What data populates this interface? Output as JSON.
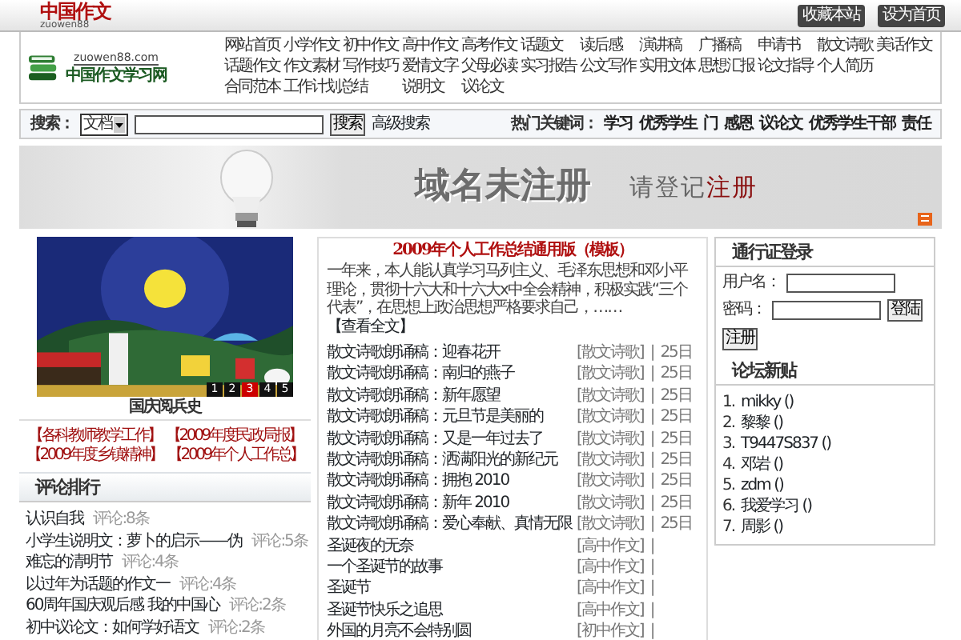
{
  "header": {
    "logo": "中国作文",
    "logo_sub": "zuowen88",
    "buttons": [
      "收藏本站",
      "设为首页"
    ]
  },
  "site": {
    "domain": "zuowen88.com",
    "name": "中国作文学习网"
  },
  "nav_rows": [
    [
      "网站首页",
      "小学作文",
      "初中作文",
      "高中作文",
      "高考作文",
      "话题文",
      "读后感",
      "演讲稿",
      "广播稿",
      "申请书",
      "散文诗歌",
      "美话作文"
    ],
    [
      "话题作文",
      "作文素材",
      "写作技巧",
      "爱情文字",
      "父母必读",
      "实习报告",
      "公文写作",
      "实用文体",
      "思想汇报",
      "论文指导",
      "个人简历"
    ],
    [
      "合同范本",
      "工作计划总结",
      "说明文",
      "议论文"
    ]
  ],
  "search": {
    "label": "搜索：",
    "select": "文档",
    "button": "搜索",
    "advanced": "高级搜索",
    "hot_label": "热门关键词：",
    "keywords": [
      "学习",
      "优秀学生",
      "门",
      "感恩",
      "议论文",
      "优秀学生干部",
      "责任"
    ]
  },
  "banner": {
    "title": "域名未注册",
    "prompt": "请登记",
    "prompt_highlight": "注册"
  },
  "slideshow": {
    "slides": [
      {
        "label": "1",
        "selected": false
      },
      {
        "label": "2",
        "selected": false
      },
      {
        "label": "3",
        "selected": true
      },
      {
        "label": "4",
        "selected": false
      },
      {
        "label": "5",
        "selected": false
      }
    ],
    "caption": "国庆阅兵史"
  },
  "featured_links": [
    "【各科教师教学工作】",
    "【2009年度民政局报】",
    "【2009年度乡镇精神】",
    "【2009年个人工作总】"
  ],
  "comment_ranking": {
    "title": "评论排行",
    "items": [
      {
        "title": "认识自我",
        "comments": "评论:8条"
      },
      {
        "title": "小学生说明文：萝卜的启示——伪",
        "comments": "评论:5条"
      },
      {
        "title": "难忘的清明节",
        "comments": "评论:4条"
      },
      {
        "title": "以过年为话题的作文一",
        "comments": "评论:4条"
      },
      {
        "title": "60周年国庆观后感 我的中国心",
        "comments": "评论:2条"
      },
      {
        "title": "初中议论文：如何学好语文",
        "comments": "评论:2条"
      }
    ]
  },
  "featured_article": {
    "title": "2009年个人工作总结通用版（模板）",
    "summary": "一年来，本人能认真学习马列主义、毛泽东思想和邓小平理论，贯彻十六大和十六大x中全会精神，积极实践“三个代表”，在思想上政治思想严格要求自己，……",
    "more": "【查看全文】"
  },
  "articles": [
    {
      "title": "散文诗歌朗诵稿：迎春花开",
      "category": "[散文诗歌]",
      "separator": "|",
      "date": "25日"
    },
    {
      "title": "散文诗歌朗诵稿：南归的燕子",
      "category": "[散文诗歌]",
      "separator": "|",
      "date": "25日"
    },
    {
      "title": "散文诗歌朗诵稿：新年愿望",
      "category": "[散文诗歌]",
      "separator": "|",
      "date": "25日"
    },
    {
      "title": "散文诗歌朗诵稿：元旦节是美丽的",
      "category": "[散文诗歌]",
      "separator": "|",
      "date": "25日"
    },
    {
      "title": "散文诗歌朗诵稿：又是一年过去了",
      "category": "[散文诗歌]",
      "separator": "|",
      "date": "25日"
    },
    {
      "title": "散文诗歌朗诵稿：洒满阳光的新纪元",
      "category": "[散文诗歌]",
      "separator": "|",
      "date": "25日"
    },
    {
      "title": "散文诗歌朗诵稿：拥抱 2010",
      "category": "[散文诗歌]",
      "separator": "|",
      "date": "25日"
    },
    {
      "title": "散文诗歌朗诵稿：新年 2010",
      "category": "[散文诗歌]",
      "separator": "|",
      "date": "25日"
    },
    {
      "title": "散文诗歌朗诵稿：爱心奉献、真情无限",
      "category": "[散文诗歌]",
      "separator": "|",
      "date": "25日"
    },
    {
      "title": "圣诞夜的无奈",
      "category": "[高中作文]",
      "separator": "|"
    },
    {
      "title": "一个圣诞节的故事",
      "category": "[高中作文]",
      "separator": "|"
    },
    {
      "title": "圣诞节",
      "category": "[高中作文]",
      "separator": "|"
    },
    {
      "title": "圣诞节快乐之追思",
      "category": "[高中作文]",
      "separator": "|"
    },
    {
      "title": "外国的月亮不会特别圆",
      "category": "[初中作文]",
      "separator": "|"
    }
  ],
  "login": {
    "title": "通行证登录",
    "username_label": "用户名：",
    "password_label": "密码：",
    "login_button": "登陆",
    "register_button": "注册"
  },
  "forum": {
    "title": "论坛新贴",
    "posts": [
      {
        "number": "1.",
        "text": "mikky ()"
      },
      {
        "number": "2.",
        "text": "黎黎 ()"
      },
      {
        "number": "3.",
        "text": "T9447S837 ()"
      },
      {
        "number": "4.",
        "text": "邓岩 ()"
      },
      {
        "number": "5.",
        "text": "zdm ()"
      },
      {
        "number": "6.",
        "text": "我爱学习 ()"
      },
      {
        "number": "7.",
        "text": "周影 ()"
      }
    ]
  }
}
